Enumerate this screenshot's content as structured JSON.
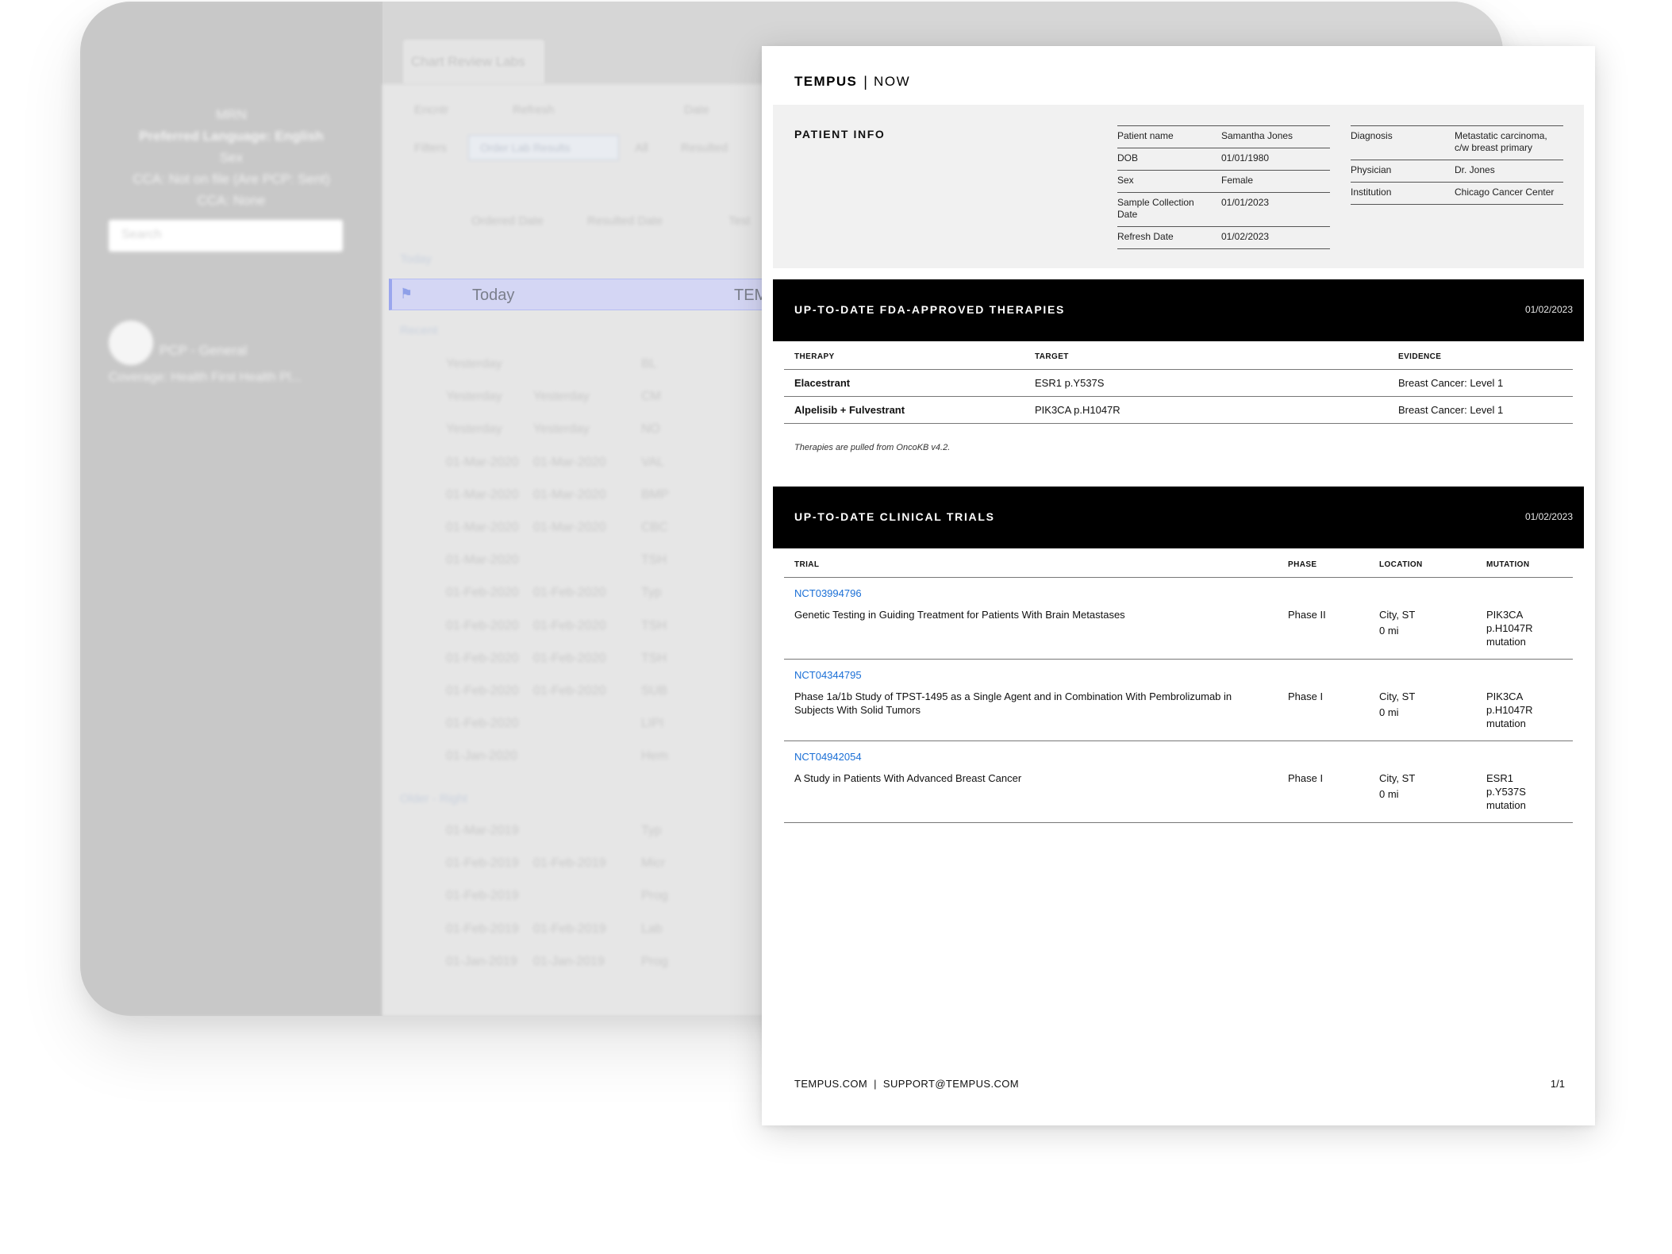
{
  "background_ehr": {
    "sidebar": {
      "lines": [
        "MRN",
        "Preferred Language: English",
        "Sex",
        "CCA: Not on file (Are PCP: Sent)",
        "CCA: None"
      ],
      "search_placeholder": "Search",
      "pcp": "PCP - General",
      "coverage": "Coverage: Health First Health Pl..."
    },
    "tab_label": "Chart Review Labs",
    "toolbar": {
      "encounters": "Encntr",
      "refresh": "Refresh",
      "date": "Date",
      "filters": "Filters",
      "button": "Order Lab Results",
      "all": "All",
      "resulted": "Resulted"
    },
    "columns": {
      "ordered": "Ordered Date",
      "resulted": "Resulted Date",
      "test": "Test"
    },
    "groups": {
      "today": "Today",
      "recent": "Recent",
      "older": "Older - Right"
    },
    "today_row": {
      "day": "Today",
      "test": "TEM"
    },
    "rows": [
      {
        "ordered": "Yesterday",
        "resulted": "",
        "test": "BL"
      },
      {
        "ordered": "Yesterday",
        "resulted": "Yesterday",
        "test": "CM"
      },
      {
        "ordered": "Yesterday",
        "resulted": "Yesterday",
        "test": "NO"
      },
      {
        "ordered": "01-Mar-2020",
        "resulted": "01-Mar-2020",
        "test": "VAL"
      },
      {
        "ordered": "01-Mar-2020",
        "resulted": "01-Mar-2020",
        "test": "BMP"
      },
      {
        "ordered": "01-Mar-2020",
        "resulted": "01-Mar-2020",
        "test": "CBC"
      },
      {
        "ordered": "01-Mar-2020",
        "resulted": "",
        "test": "TSH"
      },
      {
        "ordered": "01-Feb-2020",
        "resulted": "01-Feb-2020",
        "test": "Typ"
      },
      {
        "ordered": "01-Feb-2020",
        "resulted": "01-Feb-2020",
        "test": "TSH"
      },
      {
        "ordered": "01-Feb-2020",
        "resulted": "01-Feb-2020",
        "test": "TSH"
      },
      {
        "ordered": "01-Feb-2020",
        "resulted": "01-Feb-2020",
        "test": "SUB"
      },
      {
        "ordered": "01-Feb-2020",
        "resulted": "",
        "test": "LIPI"
      },
      {
        "ordered": "01-Jan-2020",
        "resulted": "",
        "test": "Hem"
      }
    ],
    "older_rows": [
      {
        "ordered": "01-Mar-2019",
        "resulted": "",
        "test": "Typ"
      },
      {
        "ordered": "01-Feb-2019",
        "resulted": "01-Feb-2019",
        "test": "Micr"
      },
      {
        "ordered": "01-Feb-2019",
        "resulted": "",
        "test": "Prog"
      },
      {
        "ordered": "01-Feb-2019",
        "resulted": "01-Feb-2019",
        "test": "Lab"
      },
      {
        "ordered": "01-Jan-2019",
        "resulted": "01-Jan-2019",
        "test": "Prog"
      }
    ]
  },
  "report": {
    "brand": "TEMPUS",
    "divider": "|",
    "product": "NOW",
    "patient_info": {
      "title": "PATIENT INFO",
      "left": [
        {
          "k": "Patient name",
          "v": "Samantha Jones"
        },
        {
          "k": "DOB",
          "v": "01/01/1980"
        },
        {
          "k": "Sex",
          "v": "Female"
        },
        {
          "k": "Sample Collection Date",
          "v": "01/01/2023"
        },
        {
          "k": "Refresh Date",
          "v": "01/02/2023"
        }
      ],
      "right": [
        {
          "k": "Diagnosis",
          "v": "Metastatic carcinoma, c/w breast primary"
        },
        {
          "k": "Physician",
          "v": "Dr. Jones"
        },
        {
          "k": "Institution",
          "v": "Chicago Cancer Center"
        }
      ]
    },
    "therapies": {
      "title": "UP-TO-DATE FDA-APPROVED THERAPIES",
      "date": "01/02/2023",
      "headers": {
        "therapy": "THERAPY",
        "target": "TARGET",
        "evidence": "EVIDENCE"
      },
      "rows": [
        {
          "therapy": "Elacestrant",
          "target": "ESR1 p.Y537S",
          "evidence": "Breast Cancer: Level 1"
        },
        {
          "therapy": "Alpelisib + Fulvestrant",
          "target": "PIK3CA p.H1047R",
          "evidence": "Breast Cancer: Level 1"
        }
      ],
      "note": "Therapies are pulled from OncoKB v4.2."
    },
    "trials": {
      "title": "UP-TO-DATE CLINICAL TRIALS",
      "date": "01/02/2023",
      "headers": {
        "trial": "TRIAL",
        "phase": "PHASE",
        "location": "LOCATION",
        "mutation": "MUTATION"
      },
      "rows": [
        {
          "id": "NCT03994796",
          "name": "Genetic Testing in Guiding Treatment for Patients With Brain Metastases",
          "phase": "Phase II",
          "city": "City, ST",
          "distance": "0 mi",
          "gene": "PIK3CA",
          "variant": "p.H1047R",
          "type": "mutation"
        },
        {
          "id": "NCT04344795",
          "name": "Phase 1a/1b Study of TPST-1495 as a Single Agent and in Combination With Pembrolizumab in Subjects With Solid Tumors",
          "phase": "Phase I",
          "city": "City, ST",
          "distance": "0 mi",
          "gene": "PIK3CA",
          "variant": "p.H1047R",
          "type": "mutation"
        },
        {
          "id": "NCT04942054",
          "name": "A Study in Patients With Advanced Breast Cancer",
          "phase": "Phase I",
          "city": "City, ST",
          "distance": "0 mi",
          "gene": "ESR1",
          "variant": "p.Y537S",
          "type": "mutation"
        }
      ]
    },
    "footer": {
      "website": "TEMPUS.COM",
      "separator": "|",
      "email": "SUPPORT@TEMPUS.COM",
      "page": "1/1"
    },
    "colors": {
      "link": "#1a6fd6",
      "section_bg": "#000000",
      "info_bg": "#f1f1f1",
      "highlight_row": "#d4d6f4"
    }
  }
}
